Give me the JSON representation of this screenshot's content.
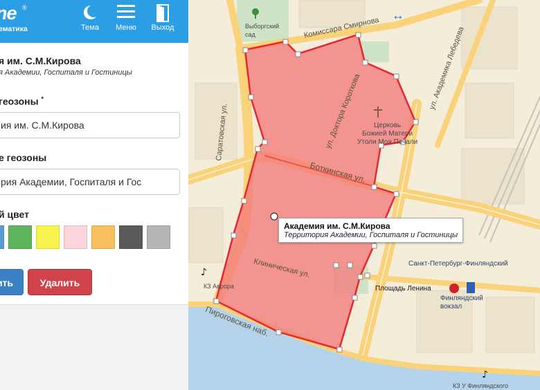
{
  "header": {
    "logo_text": "ne",
    "logo_mark": "®",
    "logo_subtitle": "ематика",
    "theme_label": "Тема",
    "menu_label": "Меню",
    "exit_label": "Выход"
  },
  "zone": {
    "title": "я им. С.М.Кирова",
    "description": "я Академии, Госпиталя и Гостиницы"
  },
  "form": {
    "name_label": "геозоны",
    "name_required_mark": "*",
    "name_value": "ия им. С.М.Кирова",
    "desc_label": "е геозоны",
    "desc_value": "рия Академии, Госпиталя и Гос",
    "color_label": "й цвет",
    "colors": [
      "#5b9ad6",
      "#5fb35a",
      "#f7f24e",
      "#fbd4dc",
      "#f8c05e",
      "#5a5a5a",
      "#b5b5b5"
    ],
    "save_label": "ить",
    "delete_label": "Удалить"
  },
  "map": {
    "streets": [
      "Комиссара Смирнова",
      "ул. Доктора Короткова",
      "Боткинская ул.",
      "Клиническая ул.",
      "Пироговская наб.",
      "Саратовская ул.",
      "ул. Академика Лебедева",
      "Боткинская ул."
    ],
    "pois": {
      "garden": "Выборгский\nсад",
      "church": "Церковь\nБожией Матери\nУтоли Моя Печали",
      "station": "Санкт-Петербург-Финляндский",
      "metro": "Площадь Ленина",
      "finland_station": "Финляндский\nвокзал",
      "kz_avrora": "КЗ Аврора",
      "kz_finland": "КЗ У Финляндского"
    },
    "tooltip_title": "Академия им. С.М.Кирова",
    "tooltip_subtitle": "Территория Академии, Госпиталя и Гостиницы"
  },
  "colors": {
    "header_bg": "#2c9ee6",
    "zone_fill": "#f27b7b",
    "zone_stroke": "#e8262e",
    "river": "#b4d3ea",
    "road": "#f9d27a",
    "park": "#cfe3c6"
  }
}
